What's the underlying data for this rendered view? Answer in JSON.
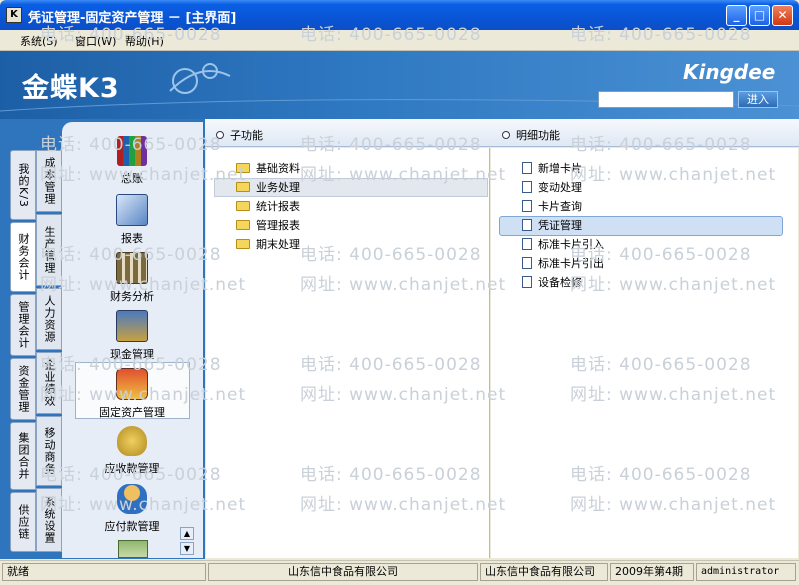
{
  "window": {
    "title": "凭证管理-固定资产管理 － [主界面]",
    "icon_label": "K"
  },
  "menu": [
    "系统(S)",
    "窗口(W)",
    "帮助(H)"
  ],
  "banner": {
    "logo": "金蝶K3",
    "brand": "Kingdee",
    "search_placeholder": "",
    "search_button": "进入"
  },
  "left_tabs": [
    "我的K/3",
    "财务会计",
    "管理会计",
    "资金管理",
    "集团合并",
    "供应链"
  ],
  "left_tabs_2": [
    "成本管理",
    "生产管理",
    "人力资源",
    "企业绩效",
    "移动商务",
    "系统设置"
  ],
  "nav_items": [
    {
      "label": "总账",
      "icon": "ledger-books-icon"
    },
    {
      "label": "报表",
      "icon": "report-icon"
    },
    {
      "label": "财务分析",
      "icon": "financial-analysis-icon"
    },
    {
      "label": "现金管理",
      "icon": "cash-management-icon"
    },
    {
      "label": "固定资产管理",
      "icon": "fixed-asset-truck-icon"
    },
    {
      "label": "应收款管理",
      "icon": "receivable-moneybag-icon"
    },
    {
      "label": "应付款管理",
      "icon": "payable-person-icon"
    }
  ],
  "sub_header": "子功能",
  "sub_items": [
    "基础资料",
    "业务处理",
    "统计报表",
    "管理报表",
    "期末处理"
  ],
  "sub_selected": 1,
  "detail_header": "明细功能",
  "detail_items": [
    "新增卡片",
    "变动处理",
    "卡片查询",
    "凭证管理",
    "标准卡片引入",
    "标准卡片引出",
    "设备检修"
  ],
  "detail_selected": 3,
  "status": {
    "ready": "就绪",
    "company1": "山东信中食品有限公司",
    "company2": "山东信中食品有限公司",
    "period": "2009年第4期",
    "user": "administrator"
  },
  "watermark": {
    "phone": "电话: 400-665-0028",
    "url": "网址: www.chanjet.net"
  },
  "colors": {
    "titlebar": "#0a55d6",
    "banner": "#2f79c2",
    "selection": "#cfe0f4"
  }
}
